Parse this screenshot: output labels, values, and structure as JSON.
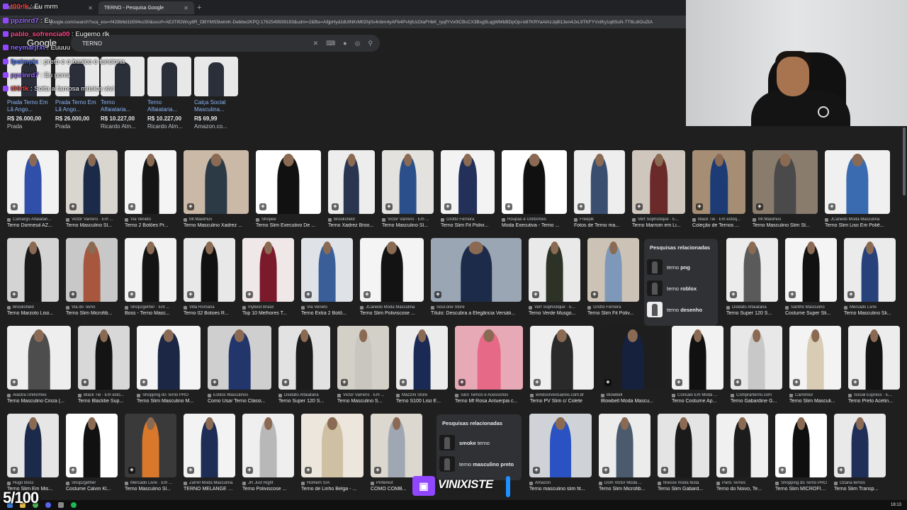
{
  "browser": {
    "tabs": [
      {
        "label": "t00rlk : Eu mrm",
        "active": false
      },
      {
        "label": "TERNO - Pesquisa Google",
        "active": true
      }
    ],
    "new_tab_icon": "plus-icon",
    "url": "google.com/search?sca_esv=f428b6d1b594cc50&sxsrf=AE3TifOWcy8R_DBYMS5lwlmK-Debbw2KPQ:1762549939193&udm=2&fbs=AIljpHydJdUtNKrM02hj0s4nbm4yAFb4PvhjlUcDtaFHkK_tyqfYVx0lCBcCX3Bsg5LqgWMbBDpOpi-b87KRYaAlAzJq8l13en4JxL9TKFYVxtKy1q6SuN-TT6LdIOoZtA"
  },
  "google": {
    "logo": "Google",
    "query": "TERNO",
    "search_icons": [
      "close-icon",
      "keyboard-icon",
      "mic-icon",
      "lens-icon",
      "search-icon"
    ]
  },
  "shopping": [
    {
      "title": "Prada Terno Em Lã Ango...",
      "price": "R$ 26.000,00",
      "store": "Prada"
    },
    {
      "title": "Prada Terno Em Lã Ango...",
      "price": "R$ 26.000,00",
      "store": "Prada"
    },
    {
      "title": "Terno Alfaiataria...",
      "price": "R$ 10.227,00",
      "store": "Ricardo Alm..."
    },
    {
      "title": "Terno Alfaiataria...",
      "price": "R$ 10.227,00",
      "store": "Ricardo Alm..."
    },
    {
      "title": "Calça Social Masculina...",
      "price": "R$ 69,99",
      "store": "Amazon.co..."
    }
  ],
  "chat": [
    {
      "user": "t00rlk",
      "text": "Eu mrm",
      "color": "#ff4040"
    },
    {
      "user": "ppzinrd7",
      "text": "Eu",
      "color": "#9a6bff"
    },
    {
      "user": "pablo_sofrencia00",
      "text": "Eugemo rlk",
      "color": "#ff4b8b"
    },
    {
      "user": "neymarjrxt",
      "text": "Euuuu",
      "color": "#8a6cff"
    },
    {
      "user": "fpsimplx",
      "text": "preto e o basico e funciona",
      "color": "#3d6bff"
    },
    {
      "user": "ppzinrd7",
      "text": "Eu porra",
      "color": "#9a6bff"
    },
    {
      "user": "t00rlk",
      "text": "Solta a famosa música vivi",
      "color": "#ff4040"
    }
  ],
  "results_rows": [
    [
      {
        "source": "Camargo Alfaiatari...",
        "title": "Terno Dormeuil AZ...",
        "bg": "#f2f2f2",
        "suit": "#2f4fa8"
      },
      {
        "source": "Victor Varrens · Em ...",
        "title": "Terno Masculino Sl...",
        "bg": "#d9d6d0",
        "suit": "#1c2a4a"
      },
      {
        "source": "Via Veneto",
        "title": "Terno 2 Botões Pr...",
        "bg": "#f4f4f4",
        "suit": "#151515"
      },
      {
        "source": "Mr.Maximus",
        "title": "Terno Masculino Xadrez ...",
        "bg": "#c9b9a6",
        "suit": "#2b3a44"
      },
      {
        "source": "Shopee",
        "title": "Terno Slim Executivo De ...",
        "bg": "#ffffff",
        "suit": "#111111"
      },
      {
        "source": "Brooksfield",
        "title": "Terno Xadrez Broo...",
        "bg": "#ededed",
        "suit": "#2a3550"
      },
      {
        "source": "Victor Varrens · Em ...",
        "title": "Terno Masculino Sl...",
        "bg": "#e4e2de",
        "suit": "#2b4f8a"
      },
      {
        "source": "Grotto Ferreira",
        "title": "Terno Slim Fit Polivi...",
        "bg": "#f3f3f3",
        "suit": "#22305a"
      },
      {
        "source": "Roupas e Uniformes",
        "title": "Moda Executiva - Terno ...",
        "bg": "#ffffff",
        "suit": "#101010"
      },
      {
        "source": "Freepik",
        "title": "Fotos de Terno ma...",
        "bg": "#eeeeee",
        "suit": "#3a4f70"
      },
      {
        "source": "Vert Sophistiqué · E...",
        "title": "Terno Marrom em Li...",
        "bg": "#cfc6bd",
        "suit": "#6b2a2a"
      },
      {
        "source": "Black Tie · Em estoq...",
        "title": "Coleção de Ternos ...",
        "bg": "#a58e74",
        "suit": "#1d3b74"
      },
      {
        "source": "Mr.Maximus",
        "title": "Terno Masculino Slim St...",
        "bg": "#8a7c6d",
        "suit": "#4a4a4a"
      },
      {
        "source": "JCanedo Moda Masculina",
        "title": "Terno Slim Liso Em Poliê...",
        "bg": "#f0f0f0",
        "suit": "#3a6ab0"
      }
    ],
    [
      {
        "source": "Brooksfield",
        "title": "Terno Marzoto Liso...",
        "bg": "#d4d4d4",
        "suit": "#1a1a1a"
      },
      {
        "source": "Via do Terno",
        "title": "Terno Slim Microfib...",
        "bg": "#c8c8c8",
        "suit": "#a8573f"
      },
      {
        "source": "Shop2gether · Em ...",
        "title": "Boss - Terno Masc...",
        "bg": "#f2f2f2",
        "suit": "#141414"
      },
      {
        "source": "Villa Romana",
        "title": "Terno 02 Botoes R...",
        "bg": "#e8e8e8",
        "suit": "#111111"
      },
      {
        "source": "mybest Brasil",
        "title": "Top 10 Melhores T...",
        "bg": "#f0e8e8",
        "suit": "#7a1a2a"
      },
      {
        "source": "Via Veneto",
        "title": "Terno Extra 2 Botõ...",
        "bg": "#dfe3e8",
        "suit": "#3a5f98"
      },
      {
        "source": "JCanedo Moda Masculina",
        "title": "Terno Slim Poliviscose ...",
        "bg": "#f4f4f4",
        "suit": "#131313"
      },
      {
        "source": "Soul.one Store",
        "title": "Título: Descubra a Elegância Versáti...",
        "bg": "#9aa6b3",
        "suit": "#1d2b4a"
      },
      {
        "source": "Vert Sophistiqué · E...",
        "title": "Terno Verde Musgo...",
        "bg": "#e9e9e9",
        "suit": "#2c3326"
      },
      {
        "source": "Grotto Ferreira",
        "title": "Terno Slim Fit Poliv...",
        "bg": "#ccc2b6",
        "suit": "#7d98b8"
      },
      {
        "source": "Diodato Alfaiataria",
        "title": "Terno Super 120 S...",
        "bg": "#ececec",
        "suit": "#5a5a5a"
      },
      {
        "source": "Santhô Masculino",
        "title": "Costume Super Sli...",
        "bg": "#f5f5f5",
        "suit": "#121212"
      },
      {
        "source": "Mercado Livre",
        "title": "Terno Masculino Sli...",
        "bg": "#ebebeb",
        "suit": "#27417a"
      }
    ],
    [
      {
        "source": "Alastra Uniformes",
        "title": "Terno Masculino Cinza (...",
        "bg": "#eeeeee",
        "suit": "#4d4d4d"
      },
      {
        "source": "Black Tie · Em esto...",
        "title": "Terno Blacktie Sup...",
        "bg": "#d8d8d8",
        "suit": "#141414"
      },
      {
        "source": "Shopping do Terno PRO",
        "title": "Terno Slim Masculino M...",
        "bg": "#f4f4f4",
        "suit": "#1b2744"
      },
      {
        "source": "Estilos Masculinos",
        "title": "Como Usar Terno Clássi...",
        "bg": "#cfcfcf",
        "suit": "#22366b"
      },
      {
        "source": "Diodato Alfaiataria",
        "title": "Terno Super 120 S...",
        "bg": "#e2e2e2",
        "suit": "#1c1c1c"
      },
      {
        "source": "Victor Varrens · Em ...",
        "title": "Terno Masculino S...",
        "bg": "#d3d0c8",
        "suit": "#c9c6c0"
      },
      {
        "source": "Mazzini Store",
        "title": "Terno S100 Liso E...",
        "bg": "#ececec",
        "suit": "#1a2a55"
      },
      {
        "source": "S&S Ternos e Acessórios",
        "title": "Terno Mf Rosa Antuerpia c...",
        "bg": "#e8a9b6",
        "suit": "#e66a88"
      },
      {
        "source": "windsorvestuarios.com.br",
        "title": "Terno PV Slim c/ Colete",
        "bg": "#efefef",
        "suit": "#2a2a2a"
      },
      {
        "source": "Blowbell",
        "title": "Blowbell Moda Mascu...",
        "bg": "#1e1e1e",
        "suit": "#15213d"
      },
      {
        "source": "Concalo Em Moda ...",
        "title": "Terno Costume Ap...",
        "bg": "#f2f2f2",
        "suit": "#111111"
      },
      {
        "source": "Comprarterno.com",
        "title": "Terno Gabardine G...",
        "bg": "#e8e8e8",
        "suit": "#c8c8c8"
      },
      {
        "source": "Carrefour",
        "title": "Terno Slim Masculi...",
        "bg": "#f3f3f3",
        "suit": "#d8ccb4"
      },
      {
        "source": "Social Express · E...",
        "title": "Terno Preto Acetin...",
        "bg": "#ededed",
        "suit": "#141414"
      }
    ],
    [
      {
        "source": "Hugo Boss",
        "title": "Terno Slim Em Mis...",
        "bg": "#e6e6e6",
        "suit": "#1b2a4a"
      },
      {
        "source": "Shop2gether",
        "title": "Costume Calvin Kl...",
        "bg": "#ffffff",
        "suit": "#111111"
      },
      {
        "source": "Mercado Livre · Em ...",
        "title": "Terno Masculino Sl...",
        "bg": "#3a3a3a",
        "suit": "#d9772a"
      },
      {
        "source": "Zarref Moda Masculina",
        "title": "TERNO MELANGE SLI...",
        "bg": "#f3f3f3",
        "suit": "#1e2d55"
      },
      {
        "source": "JR Just Right",
        "title": "Terno Poliviscose ...",
        "bg": "#efefef",
        "suit": "#b8b8b8"
      },
      {
        "source": "Homem S/A",
        "title": "Terno de Linho Belga - ...",
        "bg": "#ece6dc",
        "suit": "#cfc0a4"
      },
      {
        "source": "Pinterest",
        "title": "COMO COMB...",
        "bg": "#dcd7cf",
        "suit": "#9fa7b3"
      },
      {
        "source": "Amazon",
        "title": "Terno masculino slim fit...",
        "bg": "#cfd3d8",
        "suit": "#2a52c2"
      },
      {
        "source": "Dom Victor Moda ...",
        "title": "Terno Slim Microfib...",
        "bg": "#ececec",
        "suit": "#4c5a6e"
      },
      {
        "source": "finesse moda festa",
        "title": "Terno Slim Gabard...",
        "bg": "#e4e4e4",
        "suit": "#1a1a1a"
      },
      {
        "source": "Paris Ternos",
        "title": "Terno do Noivo, Te...",
        "bg": "#f0f0f0",
        "suit": "#1c1c1c"
      },
      {
        "source": "Shopping do Terno PRO",
        "title": "Terno Slim MICROFIBR...",
        "bg": "#ffffff",
        "suit": "#0f0f0f"
      },
      {
        "source": "Ozana ternos",
        "title": "Terno Slim Transp...",
        "bg": "#e9e9e9",
        "suit": "#1f2f58"
      }
    ]
  ],
  "related_1": {
    "heading": "Pesquisas relacionadas",
    "items": [
      {
        "prefix": "terno",
        "bold": "png",
        "thumb": "dark"
      },
      {
        "prefix": "terno",
        "bold": "roblox",
        "thumb": "dark"
      },
      {
        "prefix": "terno",
        "bold": "desenho",
        "thumb": "light"
      }
    ]
  },
  "related_2": {
    "heading": "Pesquisas relacionadas",
    "items": [
      {
        "prefix": "",
        "bold": "smoke",
        "suffix": " terno",
        "thumb": "dark"
      },
      {
        "prefix": "terno ",
        "bold": "masculino preto",
        "suffix": "",
        "thumb": "dark"
      }
    ]
  },
  "overlay": {
    "counter": "5/100",
    "twitch_name": "VINIXISTE",
    "twitch_color": "#9147ff"
  },
  "taskbar": {
    "clock": "18:13"
  }
}
